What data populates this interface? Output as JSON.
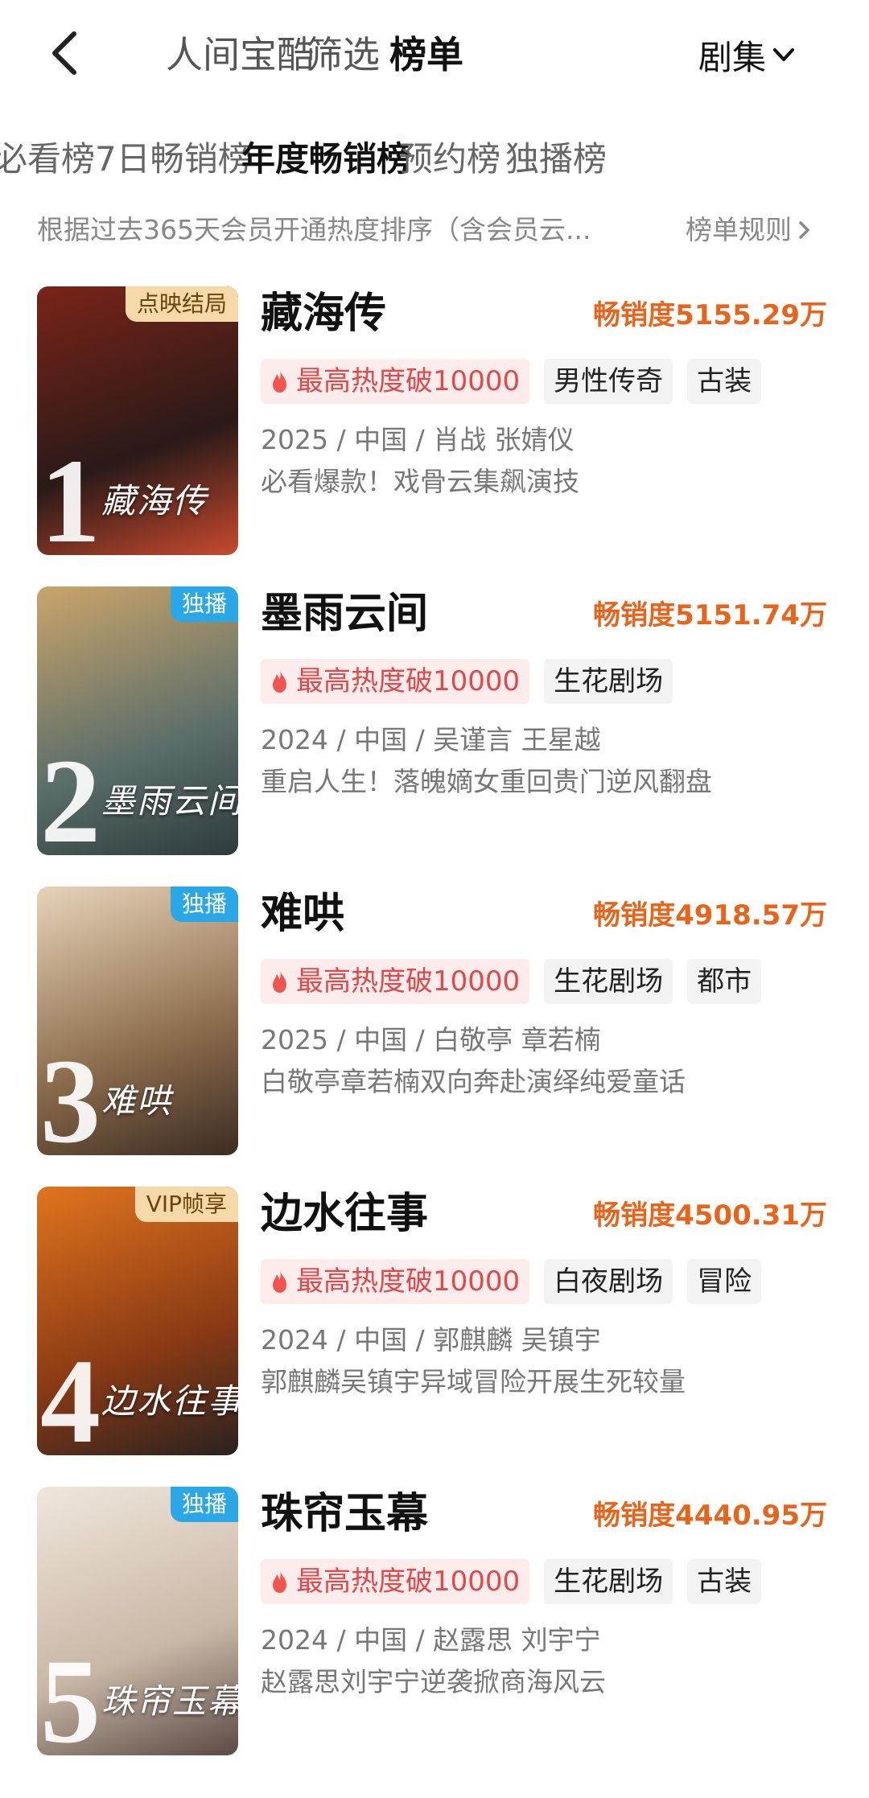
{
  "header": {
    "tabs": [
      {
        "label": "人间宝酷",
        "active": false
      },
      {
        "label": "筛选",
        "active": false
      },
      {
        "label": "榜单",
        "active": true
      }
    ],
    "category": "剧集"
  },
  "subtabs": [
    {
      "label": "必看榜",
      "active": false
    },
    {
      "label": "7日畅销榜",
      "active": false
    },
    {
      "label": "年度畅销榜",
      "active": true
    },
    {
      "label": "预约榜",
      "active": false
    },
    {
      "label": "独播榜",
      "active": false
    }
  ],
  "description": "根据过去365天会员开通热度排序（含会员云...",
  "rules_link": "榜单规则",
  "items": [
    {
      "rank": "1",
      "badge": "点映结局",
      "badge_style": "gold",
      "poster_title": "藏海传",
      "title": "藏海传",
      "sales": "畅销度5155.29万",
      "hot": "最高热度破10000",
      "tags": [
        "男性传奇",
        "古装"
      ],
      "meta": "2025 / 中国 / 肖战 张婧仪",
      "blurb": "必看爆款！戏骨云集飙演技",
      "colors": [
        "#7a2418",
        "#2a1a18",
        "#c84a2e"
      ]
    },
    {
      "rank": "2",
      "badge": "独播",
      "badge_style": "blue",
      "poster_title": "墨雨云间",
      "title": "墨雨云间",
      "sales": "畅销度5151.74万",
      "hot": "最高热度破10000",
      "tags": [
        "生花剧场"
      ],
      "meta": "2024 / 中国 / 吴谨言 王星越",
      "blurb": "重启人生！落魄嫡女重回贵门逆风翻盘",
      "colors": [
        "#caa46a",
        "#5b6e6a",
        "#2d3b3c"
      ]
    },
    {
      "rank": "3",
      "badge": "独播",
      "badge_style": "blue",
      "poster_title": "难哄",
      "title": "难哄",
      "sales": "畅销度4918.57万",
      "hot": "最高热度破10000",
      "tags": [
        "生花剧场",
        "都市"
      ],
      "meta": "2025 / 中国 / 白敬亭 章若楠",
      "blurb": "白敬亭章若楠双向奔赴演绎纯爱童话",
      "colors": [
        "#e8d3b8",
        "#8a6b4c",
        "#3c2c22"
      ]
    },
    {
      "rank": "4",
      "badge": "VIP帧享",
      "badge_style": "gold",
      "poster_title": "边水往事",
      "title": "边水往事",
      "sales": "畅销度4500.31万",
      "hot": "最高热度破10000",
      "tags": [
        "白夜剧场",
        "冒险"
      ],
      "meta": "2024 / 中国 / 郭麒麟 吴镇宇",
      "blurb": "郭麒麟吴镇宇异域冒险开展生死较量",
      "colors": [
        "#e0741e",
        "#8a3a14",
        "#2a2220"
      ]
    },
    {
      "rank": "5",
      "badge": "独播",
      "badge_style": "blue",
      "poster_title": "珠帘玉幕",
      "title": "珠帘玉幕",
      "sales": "畅销度4440.95万",
      "hot": "最高热度破10000",
      "tags": [
        "生花剧场",
        "古装"
      ],
      "meta": "2024 / 中国 / 赵露思 刘宇宁",
      "blurb": "赵露思刘宇宁逆袭掀商海风云",
      "colors": [
        "#efe6dc",
        "#c9b7a6",
        "#5a4a44"
      ]
    }
  ]
}
